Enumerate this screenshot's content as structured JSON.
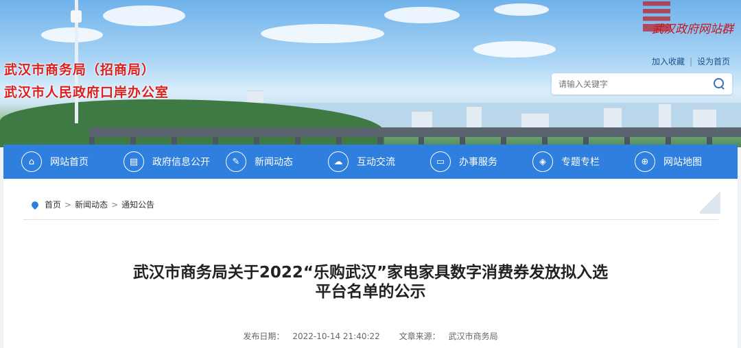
{
  "site": {
    "title_line1": "武汉市商务局（招商局）",
    "title_line2": "武汉市人民政府口岸办公室",
    "logo_text": "武汉政府网站群"
  },
  "header_links": {
    "favorite": "加入收藏",
    "separator": "|",
    "homepage": "设为首页"
  },
  "search": {
    "placeholder": "请输入关键字",
    "icon": "search-icon"
  },
  "nav": {
    "items": [
      {
        "label": "网站首页",
        "icon": "home-icon",
        "glyph": "⌂"
      },
      {
        "label": "政府信息公开",
        "icon": "document-icon",
        "glyph": "▤"
      },
      {
        "label": "新闻动态",
        "icon": "book-icon",
        "glyph": "✎"
      },
      {
        "label": "互动交流",
        "icon": "chat-icon",
        "glyph": "☁"
      },
      {
        "label": "办事服务",
        "icon": "monitor-icon",
        "glyph": "▭"
      },
      {
        "label": "专题专栏",
        "icon": "cube-icon",
        "glyph": "◈"
      },
      {
        "label": "网站地图",
        "icon": "globe-icon",
        "glyph": "⊕"
      }
    ],
    "color": "#2f7fde"
  },
  "breadcrumb": {
    "items": [
      "首页",
      "新闻动态",
      "通知公告"
    ],
    "separator": ">"
  },
  "article": {
    "title_line1": "武汉市商务局关于2022“乐购武汉”家电家具数字消费券发放拟入选",
    "title_line2": "平台名单的公示",
    "date_label": "发布日期：",
    "date_value": "2022-10-14 21:40:22",
    "source_label": "文章来源：",
    "source_value": "武汉市商务局"
  },
  "colors": {
    "title_red": "#d9201f",
    "nav_blue": "#2f7fde"
  }
}
